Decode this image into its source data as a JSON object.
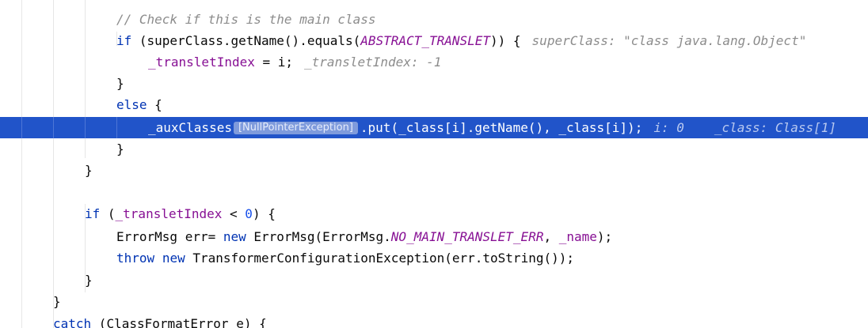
{
  "editor": {
    "lines": {
      "comment": "// Check if this is the main class",
      "if_super": {
        "kw_if": "if",
        "p1": " (superClass.getName().equals(",
        "const": "ABSTRACT_TRANSLET",
        "p2": ")) {",
        "hint": "superClass: \"class java.lang.Object\""
      },
      "assign": {
        "field": "_transletIndex",
        "rest": " = i;",
        "hint": "_transletIndex: -1"
      },
      "close1": "}",
      "else_line": {
        "kw_else": "else",
        "rest": " {"
      },
      "exec_line": {
        "field": "_auxClasses",
        "exception_badge": "[NullPointerException]",
        "rest": ".put(_class[i].getName(), _class[i]);",
        "hint_i": "i: 0",
        "hint_class": "_class: Class[1]"
      },
      "close2": "}",
      "close3": "}",
      "if_index": {
        "kw_if": "if",
        "p1": " (",
        "field": "_transletIndex",
        "p2": " < ",
        "num": "0",
        "p3": ") {"
      },
      "errmsg": {
        "p1": "ErrorMsg err= ",
        "kw_new": "new",
        "p2": " ErrorMsg(ErrorMsg.",
        "const": "NO_MAIN_TRANSLET_ERR",
        "p3": ", ",
        "field": "_name",
        "p4": ");"
      },
      "throw_line": {
        "kw_throw": "throw",
        "sp": " ",
        "kw_new": "new",
        "rest": " TransformerConfigurationException(err.toString());"
      },
      "close4": "}",
      "close5": "}",
      "catch_line": {
        "kw_catch": "catch",
        "rest": " (ClassFormatError e) {"
      }
    }
  }
}
